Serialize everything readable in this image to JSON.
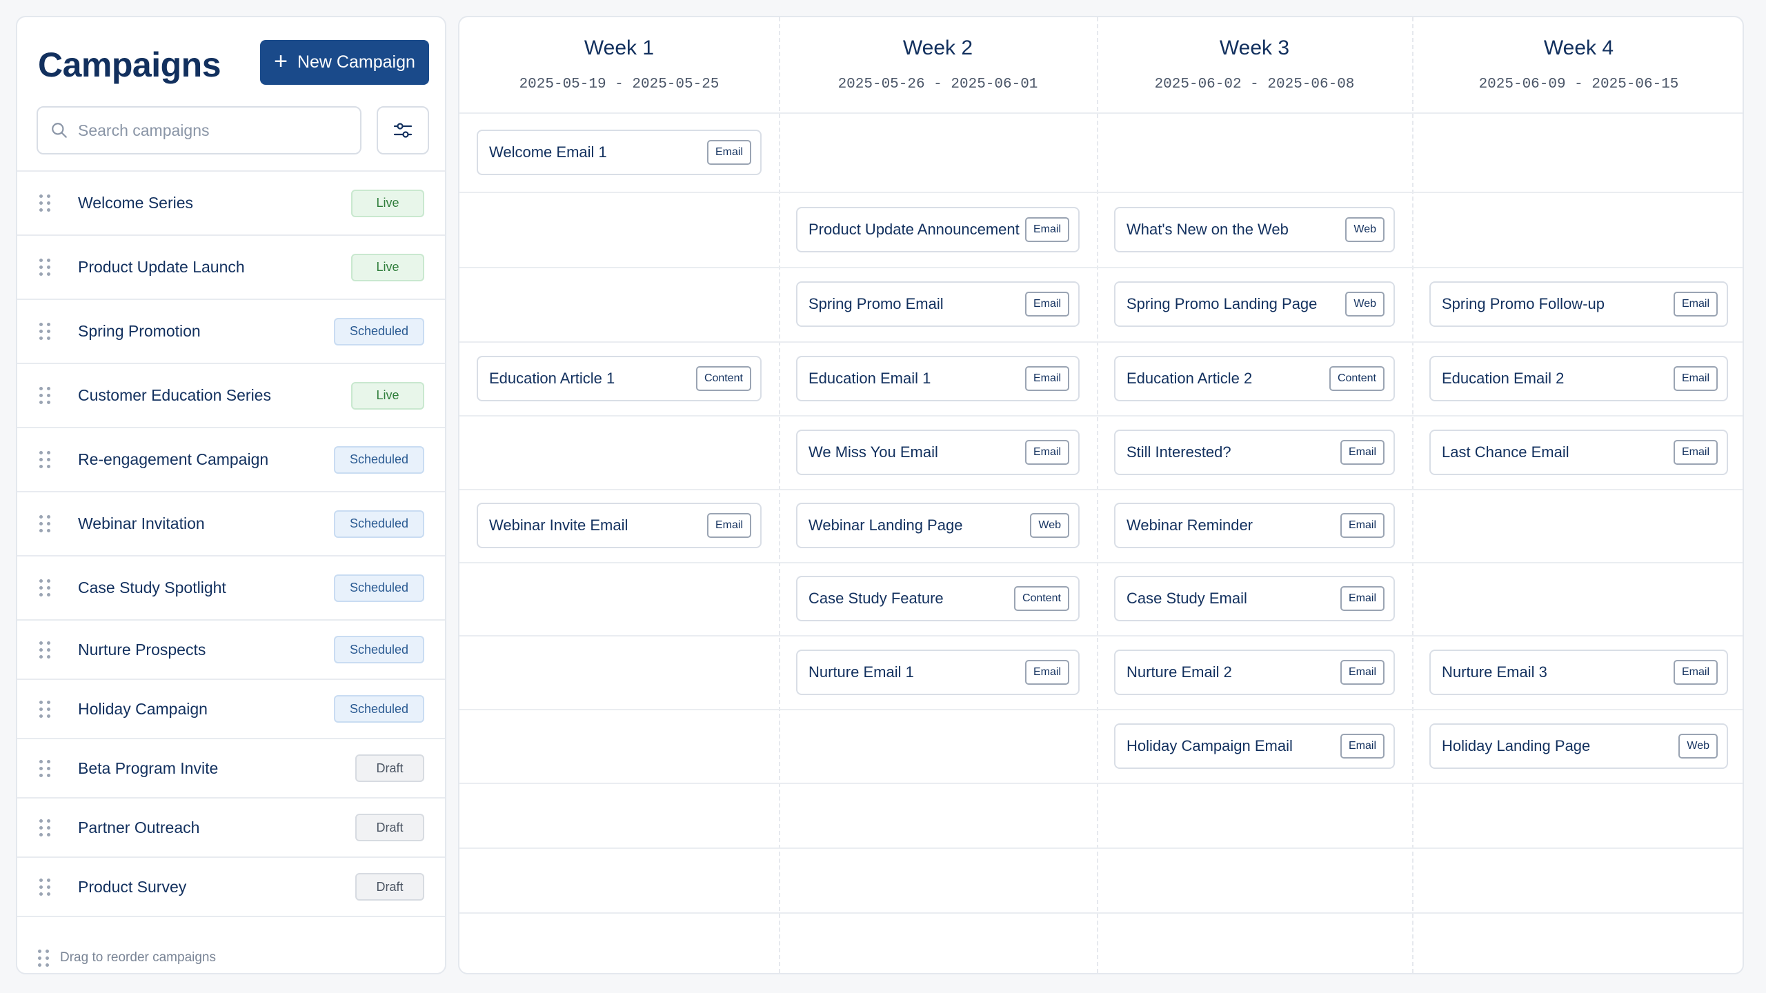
{
  "sidebar": {
    "title": "Campaigns",
    "new_button_label": "New Campaign",
    "search_placeholder": "Search campaigns",
    "footer_hint": "Drag to reorder campaigns",
    "campaigns": [
      {
        "name": "Welcome Series",
        "status": "Live"
      },
      {
        "name": "Product Update Launch",
        "status": "Live"
      },
      {
        "name": "Spring Promotion",
        "status": "Scheduled"
      },
      {
        "name": "Customer Education Series",
        "status": "Live"
      },
      {
        "name": "Re-engagement Campaign",
        "status": "Scheduled"
      },
      {
        "name": "Webinar Invitation",
        "status": "Scheduled"
      },
      {
        "name": "Case Study Spotlight",
        "status": "Scheduled"
      },
      {
        "name": "Nurture Prospects",
        "status": "Scheduled"
      },
      {
        "name": "Holiday Campaign",
        "status": "Scheduled"
      },
      {
        "name": "Beta Program Invite",
        "status": "Draft"
      },
      {
        "name": "Partner Outreach",
        "status": "Draft"
      },
      {
        "name": "Product Survey",
        "status": "Draft"
      }
    ]
  },
  "calendar": {
    "weeks": [
      {
        "label": "Week 1",
        "range": "2025-05-19 - 2025-05-25"
      },
      {
        "label": "Week 2",
        "range": "2025-05-26 - 2025-06-01"
      },
      {
        "label": "Week 3",
        "range": "2025-06-02 - 2025-06-08"
      },
      {
        "label": "Week 4",
        "range": "2025-06-09 - 2025-06-15"
      }
    ],
    "rows": [
      [
        {
          "title": "Welcome Email 1",
          "type": "Email"
        },
        null,
        null,
        null
      ],
      [
        null,
        {
          "title": "Product Update Announcement",
          "type": "Email"
        },
        {
          "title": "What's New on the Web",
          "type": "Web"
        },
        null
      ],
      [
        null,
        {
          "title": "Spring Promo Email",
          "type": "Email"
        },
        {
          "title": "Spring Promo Landing Page",
          "type": "Web"
        },
        {
          "title": "Spring Promo Follow-up",
          "type": "Email"
        }
      ],
      [
        {
          "title": "Education Article 1",
          "type": "Content"
        },
        {
          "title": "Education Email 1",
          "type": "Email"
        },
        {
          "title": "Education Article 2",
          "type": "Content"
        },
        {
          "title": "Education Email 2",
          "type": "Email"
        }
      ],
      [
        null,
        {
          "title": "We Miss You Email",
          "type": "Email"
        },
        {
          "title": "Still Interested?",
          "type": "Email"
        },
        {
          "title": "Last Chance Email",
          "type": "Email"
        }
      ],
      [
        {
          "title": "Webinar Invite Email",
          "type": "Email"
        },
        {
          "title": "Webinar Landing Page",
          "type": "Web"
        },
        {
          "title": "Webinar Reminder",
          "type": "Email"
        },
        null
      ],
      [
        null,
        {
          "title": "Case Study Feature",
          "type": "Content"
        },
        {
          "title": "Case Study Email",
          "type": "Email"
        },
        null
      ],
      [
        null,
        {
          "title": "Nurture Email 1",
          "type": "Email"
        },
        {
          "title": "Nurture Email 2",
          "type": "Email"
        },
        {
          "title": "Nurture Email 3",
          "type": "Email"
        }
      ],
      [
        null,
        null,
        {
          "title": "Holiday Campaign Email",
          "type": "Email"
        },
        {
          "title": "Holiday Landing Page",
          "type": "Web"
        }
      ],
      [
        null,
        null,
        null,
        null
      ],
      [
        null,
        null,
        null,
        null
      ],
      [
        null,
        null,
        null,
        null
      ]
    ]
  },
  "colors": {
    "primary": "#1a4a8a",
    "text": "#12305e",
    "live": "#2e7d3a",
    "scheduled": "#2a5a92",
    "draft": "#4b5563"
  }
}
